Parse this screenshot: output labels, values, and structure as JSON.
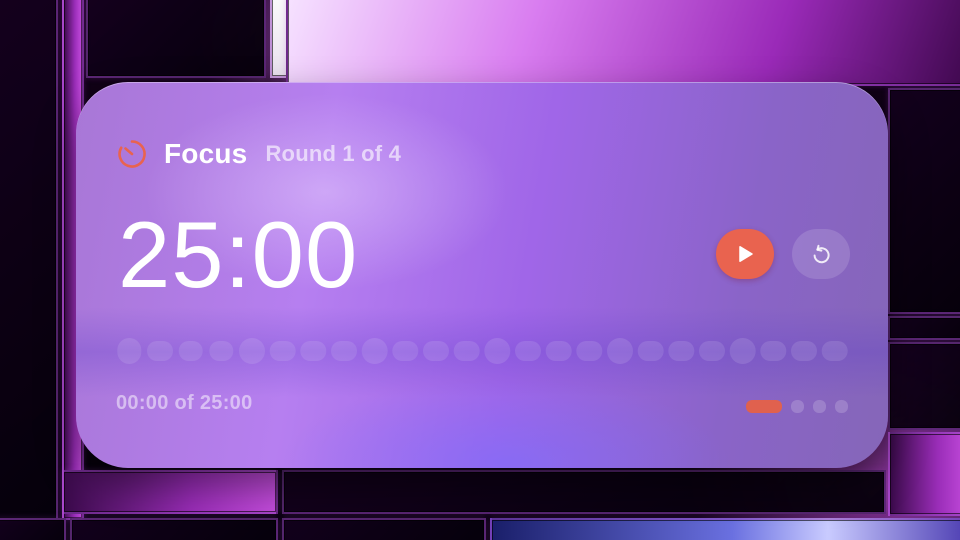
{
  "timer_widget": {
    "icon": "timer-icon",
    "title": "Focus",
    "round_label": "Round 1 of 4",
    "time_remaining": "25:00",
    "elapsed_label": "00:00 of 25:00",
    "progress": 0,
    "play_button": {
      "icon": "play-icon"
    },
    "reset_button": {
      "icon": "reset-icon"
    },
    "rounds": {
      "total": 4,
      "current": 1
    },
    "colors": {
      "accent": "#e9634f"
    }
  }
}
